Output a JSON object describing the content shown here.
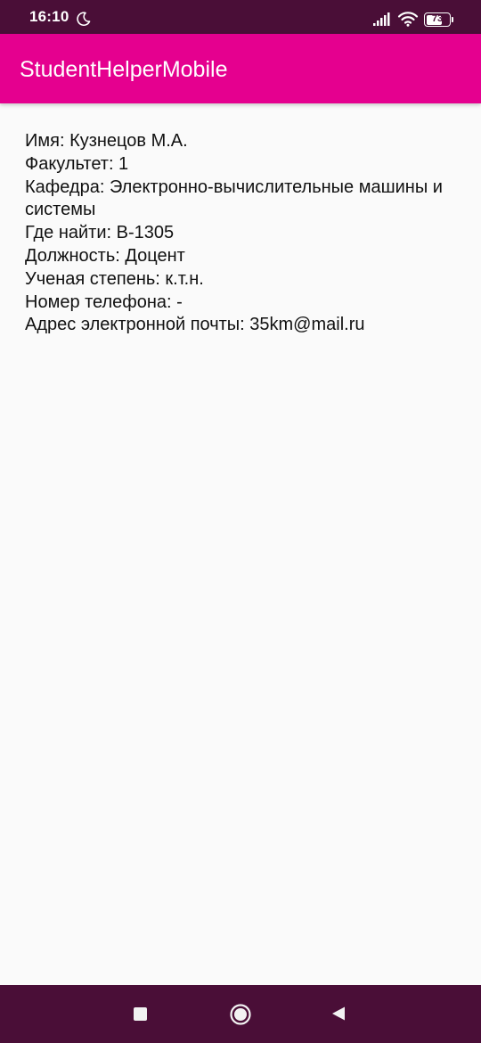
{
  "colors": {
    "status_bar": "#4a0e37",
    "app_bar": "#e5008f",
    "nav_bar": "#4a0e37",
    "background": "#fafafa",
    "text": "#111111"
  },
  "status_bar": {
    "time": "16:10",
    "battery_level": "73",
    "icons": [
      "moon-icon",
      "signal-icon",
      "wifi-icon",
      "battery-icon"
    ]
  },
  "app_bar": {
    "title": "StudentHelperMobile"
  },
  "teacher_info": {
    "lines": [
      "Имя: Кузнецов М.А.",
      "Факультет: 1",
      "Кафедра: Электронно-вычислительные машины и системы",
      "Где найти: В-1305",
      "Должность: Доцент",
      "Ученая степень: к.т.н.",
      "Номер телефона: -",
      "Адрес электронной почты: 35km@mail.ru"
    ]
  },
  "nav_bar": {
    "icons": [
      "recent-apps-icon",
      "home-icon",
      "back-icon"
    ]
  }
}
